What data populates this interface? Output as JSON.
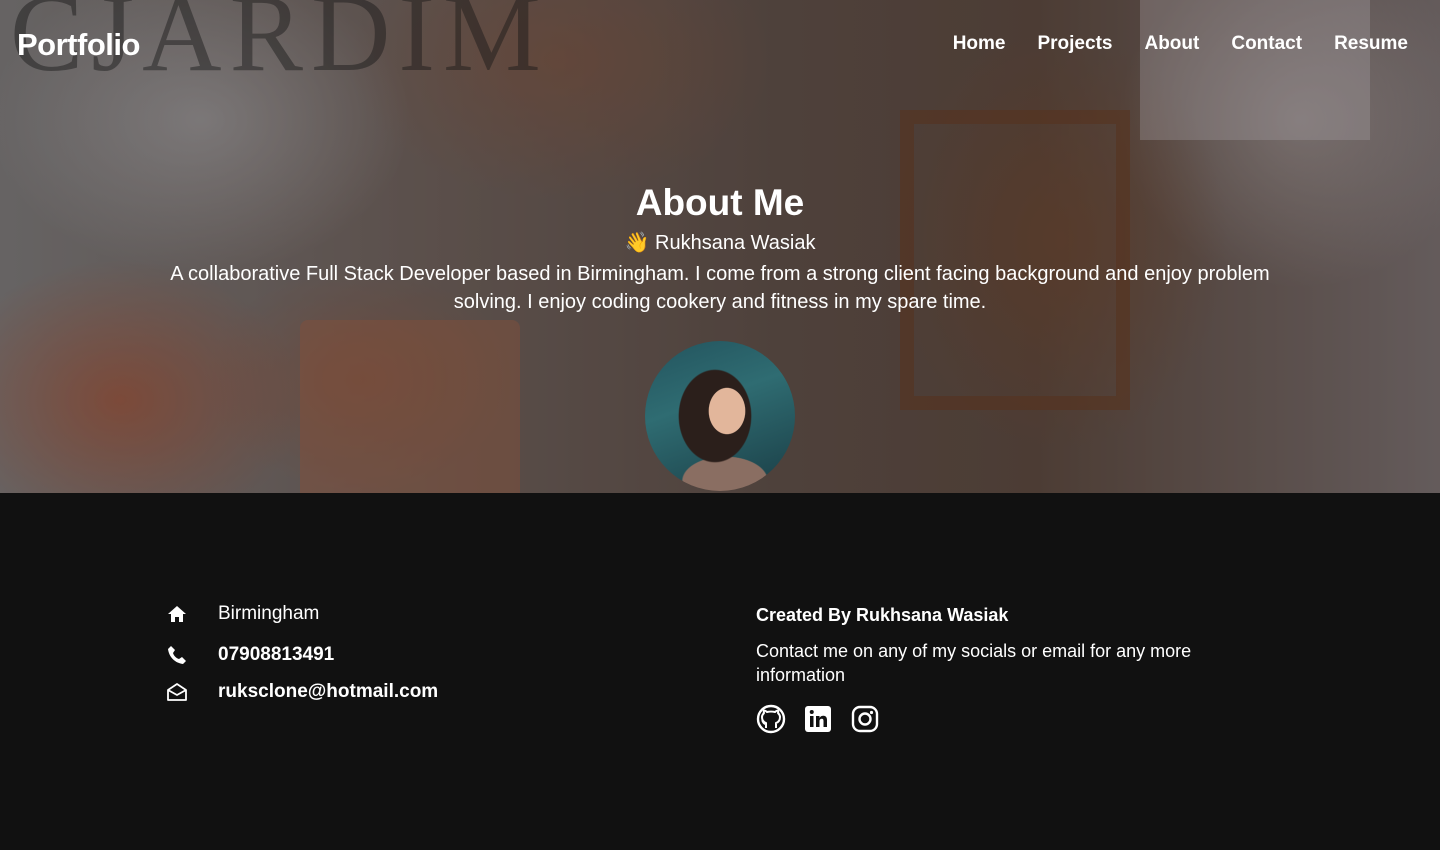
{
  "nav": {
    "brand": "Portfolio",
    "links": [
      "Home",
      "Projects",
      "About",
      "Contact",
      "Resume"
    ]
  },
  "hero": {
    "title": "About Me",
    "subtitle": "👋 Rukhsana Wasiak",
    "bio": "A collaborative Full Stack Developer based in Birmingham. I come from a strong client facing background and enjoy problem solving. I enjoy coding cookery and fitness in my spare time."
  },
  "footer": {
    "city": "Birmingham",
    "phone": "07908813491",
    "email": "ruksclone@hotmail.com",
    "created_by": "Created By Rukhsana Wasiak",
    "contact_note": "Contact me on any of my socials or email for any more information",
    "icons": [
      "home-icon",
      "phone-icon",
      "envelope-icon",
      "github-icon",
      "linkedin-icon",
      "instagram-icon"
    ]
  }
}
